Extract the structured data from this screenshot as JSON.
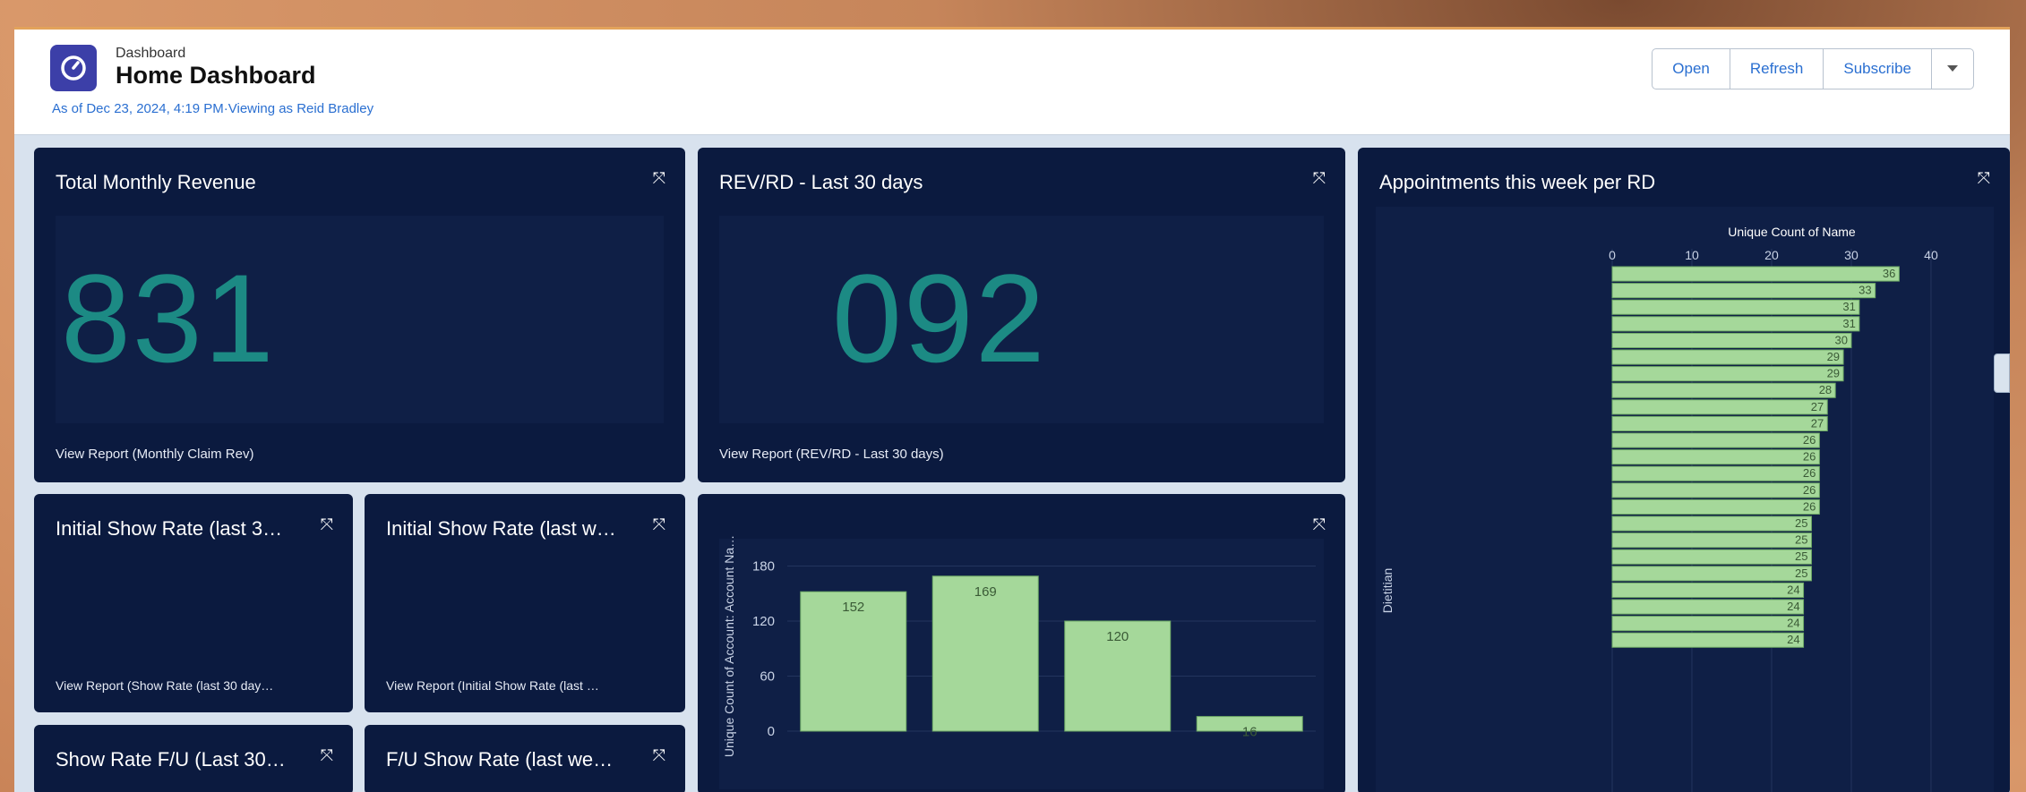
{
  "header": {
    "eyebrow": "Dashboard",
    "title": "Home Dashboard",
    "subtitle": "As of Dec 23, 2024, 4:19 PM·Viewing as Reid Bradley",
    "buttons": {
      "open": "Open",
      "refresh": "Refresh",
      "subscribe": "Subscribe",
      "menu_icon": "chevron-down-icon"
    }
  },
  "tiles": {
    "revenue": {
      "title": "Total Monthly Revenue",
      "value": "831",
      "link": "View Report (Monthly Claim Rev)"
    },
    "revrd": {
      "title": "REV/RD - Last 30 days",
      "value": "092",
      "link": "View Report (REV/RD - Last 30 days)"
    },
    "show1": {
      "title": "Initial Show Rate (last 3…",
      "link": "View Report (Show Rate (last 30 day…"
    },
    "show2": {
      "title": "Initial Show Rate (last w…",
      "link": "View Report (Initial Show Rate (last …"
    },
    "show3": {
      "title": "Show Rate F/U (Last 30…"
    },
    "show4": {
      "title": "F/U Show Rate (last we…"
    },
    "appointments": {
      "title": "Appointments this week per RD"
    }
  },
  "colors": {
    "tile_bg": "#0b1a3f",
    "metric": "#1c8a84",
    "bar": "#a5d89a",
    "link": "#2a6fd1"
  },
  "chart_data": [
    {
      "type": "bar",
      "ylabel": "Unique Count of Account: Account Na…",
      "yticks": [
        0,
        60,
        120,
        180
      ],
      "ylim": [
        0,
        200
      ],
      "values": [
        152,
        169,
        120,
        16
      ]
    },
    {
      "type": "bar",
      "orientation": "horizontal",
      "xlabel": "Unique Count of Name",
      "xticks": [
        0,
        10,
        20,
        30,
        40
      ],
      "xlim": [
        0,
        40
      ],
      "group_label": "Dietitian",
      "values": [
        36,
        33,
        31,
        31,
        30,
        29,
        29,
        28,
        27,
        27,
        26,
        26,
        26,
        26,
        26,
        25,
        25,
        25,
        25,
        24,
        24,
        24,
        24
      ]
    }
  ]
}
